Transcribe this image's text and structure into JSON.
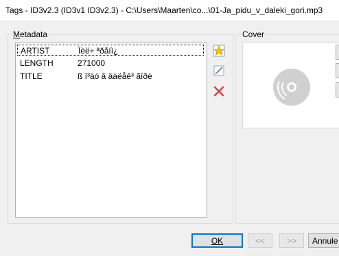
{
  "window": {
    "title": "Tags - ID3v2.3 (ID3v1 ID3v2.3) - C:\\Users\\Maarten\\co...\\01-Ja_pidu_v_daleki_gori.mp3"
  },
  "metadata": {
    "group_label_accel": "M",
    "group_label_rest": "etadata",
    "rows": [
      {
        "key": "ARTIST",
        "value": "Ïèë÷ ªðåíì¿"
      },
      {
        "key": "LENGTH",
        "value": "271000"
      },
      {
        "key": "TITLE",
        "value": "ß ï³äó â äàëåê³ ãîðè"
      }
    ],
    "selected_row": 0
  },
  "toolbar": {
    "add_icon": "star-new-icon",
    "edit_icon": "edit-icon",
    "delete_icon": "delete-x-icon"
  },
  "cover": {
    "group_label": "Cover",
    "placeholder_icon": "disc-icon"
  },
  "buttons": {
    "ok": "OK",
    "prev": "<<",
    "next": ">>",
    "cancel": "Annule"
  },
  "colors": {
    "focus": "#0078d7",
    "delete": "#e04040",
    "star": "#f5c400"
  }
}
